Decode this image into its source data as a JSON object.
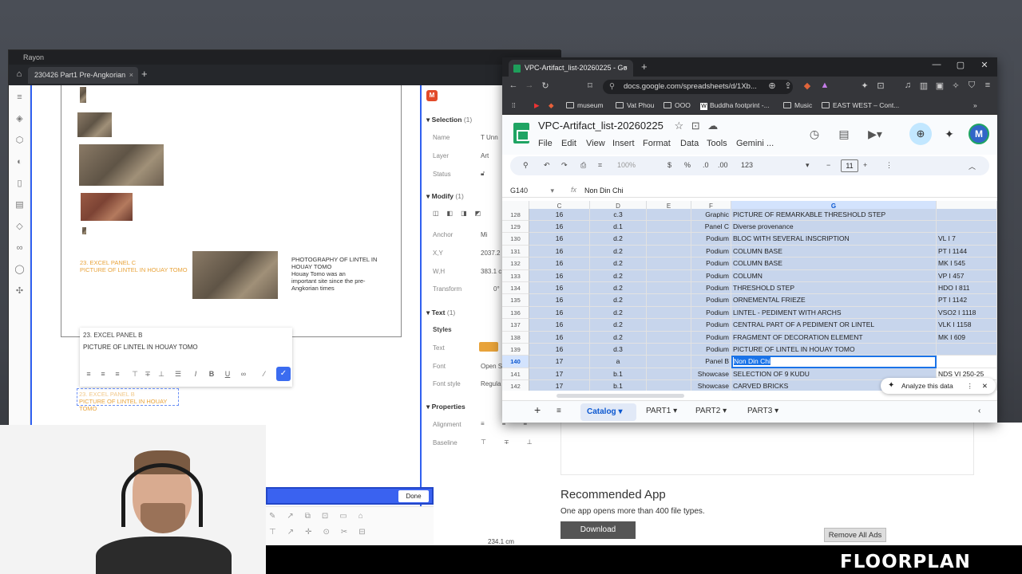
{
  "rayon": {
    "app_name": "Rayon",
    "tab_title": "230426 Part1 Pre-Angkorian",
    "canvas": {
      "orange_caption_1": "23. EXCEL PANEL C",
      "orange_caption_2": "PICTURE OF LINTEL IN HOUAY TOMO",
      "photo_caption_1": "PHOTOGRAPHY OF LINTEL IN",
      "photo_caption_2": "HOUAY TOMO",
      "photo_caption_3": "Houay Tomo was an",
      "photo_caption_4": "important site since the pre-",
      "photo_caption_5": "Angkorian times",
      "edit_line_1": "23. EXCEL PANEL B",
      "edit_line_2": "PICTURE OF LINTEL IN HOUAY TOMO",
      "sel_line_1": "23. EXCEL PANEL B",
      "sel_line_2": "PICTURE OF LINTEL IN HOUAY TOMO"
    },
    "props": {
      "avatar_letter": "M",
      "selection_header": "Selection",
      "selection_count": "(1)",
      "name_label": "Name",
      "name_value": "T  Unn",
      "layer_label": "Layer",
      "layer_value": "Art",
      "status_label": "Status",
      "modify_header": "Modify",
      "modify_count": "(1)",
      "anchor_label": "Anchor",
      "anchor_value": "Mi",
      "xy_label": "X,Y",
      "xy_value": "2037.2",
      "wh_label": "W,H",
      "wh_value": "383.1 c",
      "transform_label": "Transform",
      "transform_value": "0°",
      "text_header": "Text",
      "text_count": "(1)",
      "styles_label": "Styles",
      "text_label": "Text",
      "font_label": "Font",
      "font_value": "Open S",
      "fontstyle_label": "Font style",
      "fontstyle_value": "Regula",
      "properties_label": "Properties",
      "alignment_label": "Alignment",
      "baseline_label": "Baseline"
    },
    "done_label": "Done",
    "zoom_readout": "234.1 cm",
    "text_color": "#e8a33a"
  },
  "chrome": {
    "tab_title": "VPC-Artifact_list-20260225 - Go",
    "url": "docs.google.com/spreadsheets/d/1Xb...",
    "bookmarks": [
      "museum",
      "Vat Phou",
      "OOO",
      "Buddha footprint -...",
      "Music",
      "EAST WEST – Cont..."
    ]
  },
  "sheets": {
    "title": "VPC-Artifact_list-20260225",
    "menus": [
      "File",
      "Edit",
      "View",
      "Insert",
      "Format",
      "Data",
      "Tools",
      "Gemini",
      "..."
    ],
    "zoom": "100%",
    "currency": "$",
    "percent": "%",
    "dec_less": ".0",
    "dec_more": ".00",
    "num_format": "123",
    "font_size": "11",
    "name_box": "G140",
    "formula": "Non Din Chi",
    "columns": [
      "C",
      "D",
      "E",
      "F",
      "G"
    ],
    "rows": [
      {
        "n": "128",
        "c": "16",
        "d": "c.3",
        "e": "",
        "f": "Graphic",
        "g": "PICTURE OF REMARKABLE THRESHOLD STEP",
        "h": ""
      },
      {
        "n": "129",
        "c": "16",
        "d": "d.1",
        "e": "",
        "f": "Panel C",
        "g": "Diverse provenance",
        "h": ""
      },
      {
        "n": "130",
        "c": "16",
        "d": "d.2",
        "e": "",
        "f": "Podium",
        "g": "BLOC WITH SEVERAL INSCRIPTION",
        "h": "VL I 7"
      },
      {
        "n": "131",
        "c": "16",
        "d": "d.2",
        "e": "",
        "f": "Podium",
        "g": "COLUMN BASE",
        "h": "PT I 1144"
      },
      {
        "n": "132",
        "c": "16",
        "d": "d.2",
        "e": "",
        "f": "Podium",
        "g": "COLUMN BASE",
        "h": "MK I 545"
      },
      {
        "n": "133",
        "c": "16",
        "d": "d.2",
        "e": "",
        "f": "Podium",
        "g": "COLUMN",
        "h": "VP I 457"
      },
      {
        "n": "134",
        "c": "16",
        "d": "d.2",
        "e": "",
        "f": "Podium",
        "g": "THRESHOLD STEP",
        "h": "HDO I 811"
      },
      {
        "n": "135",
        "c": "16",
        "d": "d.2",
        "e": "",
        "f": "Podium",
        "g": "ORNEMENTAL FRIEZE",
        "h": "PT I 1142"
      },
      {
        "n": "136",
        "c": "16",
        "d": "d.2",
        "e": "",
        "f": "Podium",
        "g": "LINTEL - PEDIMENT WITH ARCHS",
        "h": "VSO2 I 1118"
      },
      {
        "n": "137",
        "c": "16",
        "d": "d.2",
        "e": "",
        "f": "Podium",
        "g": "CENTRAL PART OF A PEDIMENT OR LINTEL",
        "h": "VLK I 1158"
      },
      {
        "n": "138",
        "c": "16",
        "d": "d.2",
        "e": "",
        "f": "Podium",
        "g": "FRAGMENT OF DECORATION ELEMENT",
        "h": "MK I 609"
      },
      {
        "n": "139",
        "c": "16",
        "d": "d.3",
        "e": "",
        "f": "Podium",
        "g": "PICTURE OF LINTEL IN HOUAY TOMO",
        "h": ""
      },
      {
        "n": "140",
        "c": "17",
        "d": "a",
        "e": "",
        "f": "Panel B",
        "g": "Non Din Chi",
        "h": ""
      },
      {
        "n": "141",
        "c": "17",
        "d": "b.1",
        "e": "",
        "f": "Showcase",
        "g": "SELECTION OF 9 KUDU",
        "h": "NDS VI 250-25"
      },
      {
        "n": "142",
        "c": "17",
        "d": "b.1",
        "e": "",
        "f": "Showcase",
        "g": "CARVED BRICKS",
        "h": ""
      }
    ],
    "analyze_label": "Analyze this data",
    "sheet_tabs": [
      "Catalog",
      "PART1",
      "PART2",
      "PART3"
    ]
  },
  "background_page": {
    "recommended_title": "Recommended App",
    "recommended_sub": "One app opens more than 400 file types.",
    "download_label": "Download",
    "remove_ads_label": "Remove All Ads"
  },
  "brand": "FLOORPLAN"
}
